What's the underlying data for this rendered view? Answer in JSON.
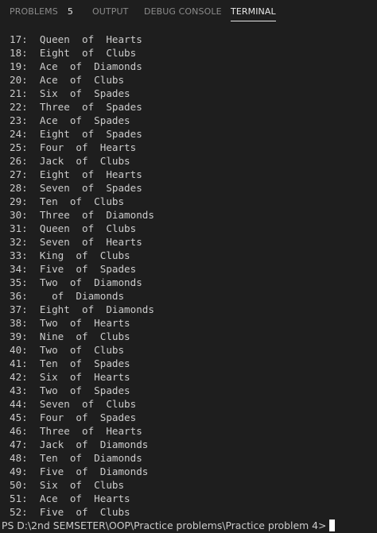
{
  "tabs": [
    {
      "label": "PROBLEMS",
      "badge": "5",
      "active": false
    },
    {
      "label": "OUTPUT",
      "active": false
    },
    {
      "label": "DEBUG CONSOLE",
      "active": false
    },
    {
      "label": "TERMINAL",
      "active": true
    }
  ],
  "terminal": {
    "lines": [
      "17:  Queen  of  Hearts",
      "18:  Eight  of  Clubs",
      "19:  Ace  of  Diamonds",
      "20:  Ace  of  Clubs",
      "21:  Six  of  Spades",
      "22:  Three  of  Spades",
      "23:  Ace  of  Spades",
      "24:  Eight  of  Spades",
      "25:  Four  of  Hearts",
      "26:  Jack  of  Clubs",
      "27:  Eight  of  Hearts",
      "28:  Seven  of  Spades",
      "29:  Ten  of  Clubs",
      "30:  Three  of  Diamonds",
      "31:  Queen  of  Clubs",
      "32:  Seven  of  Hearts",
      "33:  King  of  Clubs",
      "34:  Five  of  Spades",
      "35:  Two  of  Diamonds",
      "36:    of  Diamonds",
      "37:  Eight  of  Diamonds",
      "38:  Two  of  Hearts",
      "39:  Nine  of  Clubs",
      "40:  Two  of  Clubs",
      "41:  Ten  of  Spades",
      "42:  Six  of  Hearts",
      "43:  Two  of  Spades",
      "44:  Seven  of  Clubs",
      "45:  Four  of  Spades",
      "46:  Three  of  Hearts",
      "47:  Jack  of  Diamonds",
      "48:  Ten  of  Diamonds",
      "49:  Five  of  Diamonds",
      "50:  Six  of  Clubs",
      "51:  Ace  of  Hearts",
      "52:  Five  of  Clubs"
    ],
    "prompt": "PS D:\\2nd SEMSETER\\OOP\\Practice problems\\Practice problem 4>"
  }
}
